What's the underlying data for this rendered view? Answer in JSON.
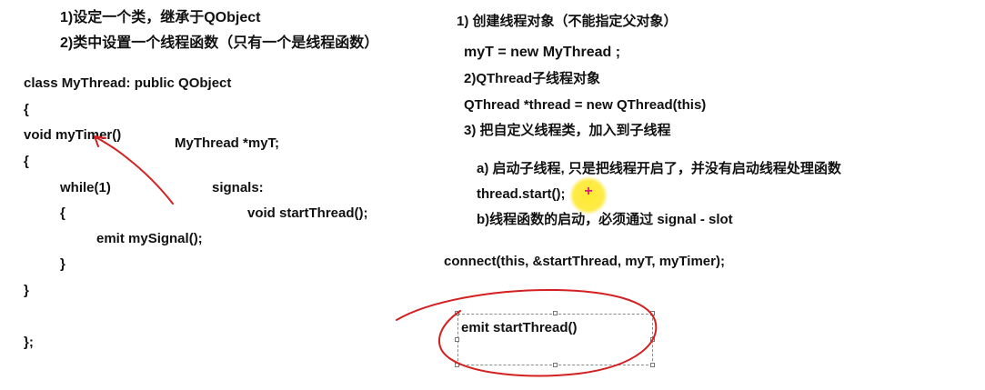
{
  "left": {
    "step1": "1)设定一个类，继承于QObject",
    "step2": "2)类中设置一个线程函数（只有一个是线程函数）",
    "code": {
      "class_decl": "class MyThread: public QObject",
      "open_brace1": "{",
      "func_decl": "void myTimer()",
      "open_brace2": "{",
      "while_stmt": "while(1)",
      "open_brace3": "{",
      "emit_stmt": "emit mySignal();",
      "close_brace3": "}",
      "close_brace2": "}",
      "close_class": "};"
    },
    "member_decl": "MyThread *myT;",
    "signals_label": "signals:",
    "signal_decl": "void startThread();"
  },
  "right": {
    "step1": "1) 创建线程对象（不能指定父对象）",
    "line_new_mythread": "myT = new MyThread ;",
    "step2": "2)QThread子线程对象",
    "line_new_qthread": "QThread *thread = new QThread(this)",
    "step3": "3) 把自定义线程类，加入到子线程",
    "sub_a": "a) 启动子线程, 只是把线程开启了，并没有启动线程处理函数",
    "line_start": "thread.start();",
    "sub_b": "b)线程函数的启动，必须通过 signal - slot",
    "connect_line": "connect(this, &startThread, myT, myTimer);",
    "emit_box": "emit startThread()"
  },
  "annotations": {
    "ink_color": "#d42020",
    "cursor_highlight_color": "#ffe828",
    "cursor_plus_color": "#e0197d"
  }
}
